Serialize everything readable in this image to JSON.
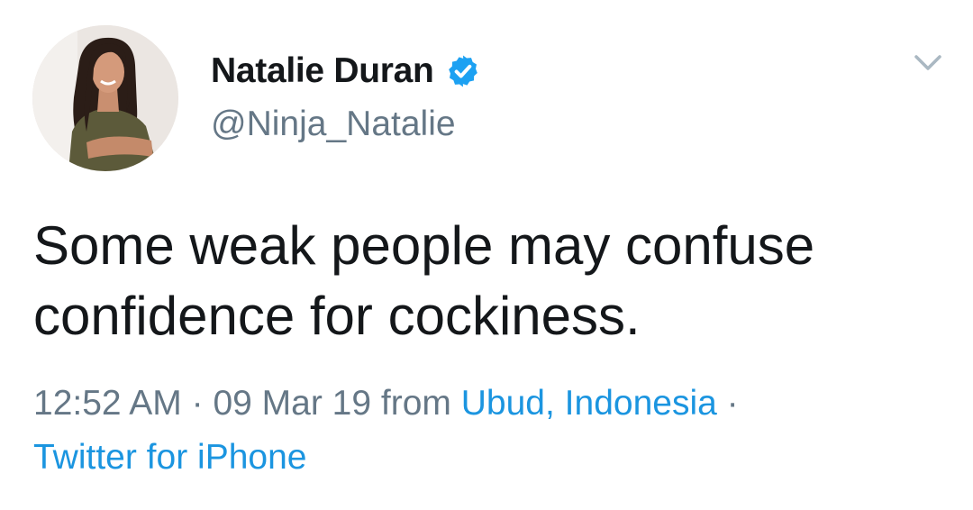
{
  "author": {
    "display_name": "Natalie Duran",
    "handle": "@Ninja_Natalie",
    "verified": true,
    "avatar_icon": "profile-photo",
    "verified_icon": "verified-badge-icon"
  },
  "tweet": {
    "text_line_1": "Some weak people may confuse",
    "text_line_2": "confidence for cockiness."
  },
  "meta": {
    "time": "12:52 AM",
    "date": "09 Mar 19",
    "from_label": "from",
    "location": "Ubud, Indonesia",
    "separator": "·",
    "source": "Twitter for iPhone"
  },
  "menu": {
    "caret_icon": "chevron-down-icon"
  },
  "colors": {
    "text_primary": "#14171a",
    "text_secondary": "#657786",
    "link": "#1b95e0",
    "verified": "#1da1f2",
    "background": "#ffffff"
  }
}
